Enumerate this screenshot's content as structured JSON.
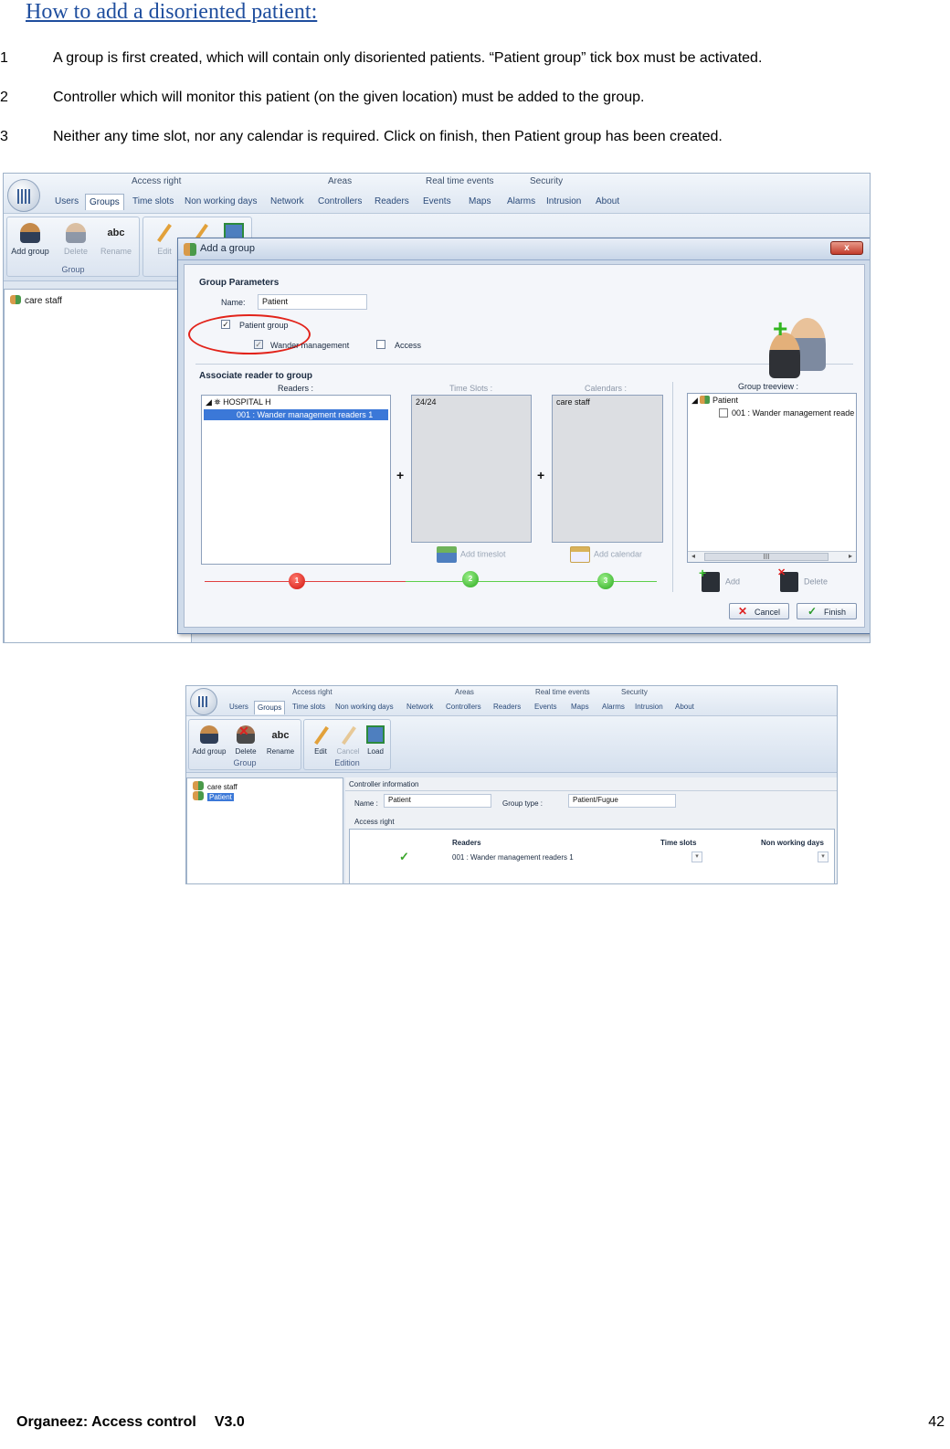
{
  "title": "How to add a disoriented patient:",
  "steps": [
    {
      "num": "1",
      "text": "A group is first created, which will contain only disoriented patients. “Patient group” tick box must be activated."
    },
    {
      "num": "2",
      "text": "Controller which will monitor this patient (on the given location) must be added to the group."
    },
    {
      "num": "3",
      "text": "Neither any time slot, nor any calendar is required. Click on finish, then Patient group has been created."
    }
  ],
  "shot1": {
    "ribbon_groups": [
      "Access right",
      "Areas",
      "Real time events",
      "Security"
    ],
    "tabs": [
      "Users",
      "Groups",
      "Time slots",
      "Non working days",
      "Network",
      "Controllers",
      "Readers",
      "Events",
      "Maps",
      "Alarms",
      "Intrusion",
      "About"
    ],
    "toolbar": {
      "add_group": "Add group",
      "delete": "Delete",
      "rename": "Rename",
      "edit": "Edit",
      "group_label": "Group"
    },
    "left_tree": [
      "care staff"
    ],
    "dialog": {
      "title": "Add a group",
      "close": "x",
      "group_parameters": "Group Parameters",
      "name_label": "Name:",
      "name_value": "Patient",
      "patient_group": "Patient group",
      "wander_management": "Wander management",
      "access": "Access",
      "associate_reader": "Associate reader to group",
      "readers_label": "Readers :",
      "time_slots_label": "Time Slots :",
      "calendars_label": "Calendars :",
      "group_treeview_label": "Group treeview :",
      "reader_root": "HOSPITAL H",
      "reader_item": "001 : Wander management readers 1",
      "time_slot_item": "24/24",
      "calendar_item": "care staff",
      "tree_root": "Patient",
      "tree_item": "001 : Wander management reade",
      "add_timeslot": "Add timeslot",
      "add_calendar": "Add calendar",
      "add": "Add",
      "delete": "Delete",
      "cancel": "Cancel",
      "finish": "Finish",
      "steps": [
        "1",
        "2",
        "3"
      ],
      "scroll_thumb": "III"
    }
  },
  "shot2": {
    "ribbon_groups": [
      "Access right",
      "Areas",
      "Real time events",
      "Security"
    ],
    "tabs": [
      "Users",
      "Groups",
      "Time slots",
      "Non working days",
      "Network",
      "Controllers",
      "Readers",
      "Events",
      "Maps",
      "Alarms",
      "Intrusion",
      "About"
    ],
    "toolbar": {
      "add_group": "Add group",
      "delete": "Delete",
      "rename": "Rename",
      "group_label": "Group",
      "edit": "Edit",
      "cancel": "Cancel",
      "load": "Load",
      "edition_label": "Edition"
    },
    "left_tree": [
      "care staff",
      "Patient"
    ],
    "controller_information": "Controller information",
    "name_label": "Name :",
    "name_value": "Patient",
    "group_type_label": "Group type :",
    "group_type_value": "Patient/Fugue",
    "access_right": "Access right",
    "col_readers": "Readers",
    "col_time_slots": "Time slots",
    "col_non_working": "Non working days",
    "row_reader": "001 : Wander management readers 1"
  },
  "footer": {
    "product": "Organeez: Access control",
    "version": "V3.0",
    "page": "42"
  }
}
